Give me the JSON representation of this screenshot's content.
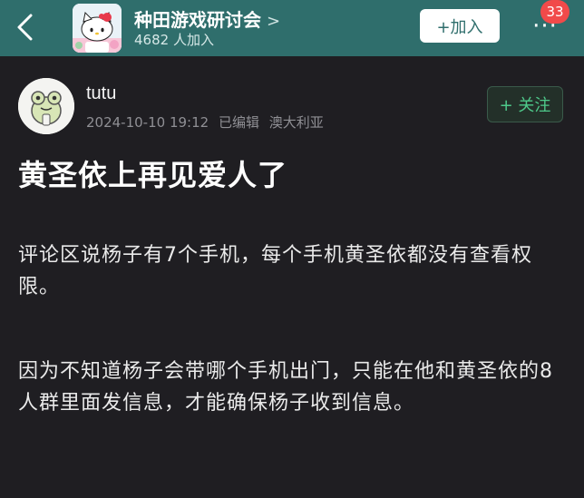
{
  "header": {
    "back_icon": "chevron-left-icon",
    "group_icon": "hello-kitty-group-avatar",
    "group_name": "种田游戏研讨会",
    "chevron": ">",
    "member_count": "4682 人加入",
    "join_label": "+加入",
    "more_icon": "more-dots-icon",
    "more_label": "···",
    "badge_count": "33",
    "theme_color": "#2f6e6c",
    "badge_color": "#f14a4a"
  },
  "post": {
    "author": {
      "avatar_icon": "frog-avatar",
      "username": "tutu"
    },
    "meta": {
      "timestamp": "2024-10-10 19:12",
      "edited": "已编辑",
      "location": "澳大利亚"
    },
    "follow_label": "+ 关注",
    "title": "黄圣依上再见爱人了",
    "paragraphs": [
      "评论区说杨子有7个手机，每个手机黄圣依都没有查看权限。",
      "因为不知道杨子会带哪个手机出门，只能在他和黄圣依的8人群里面发信息，才能确保杨子收到信息。"
    ],
    "follow_color": "#4ec98a"
  }
}
